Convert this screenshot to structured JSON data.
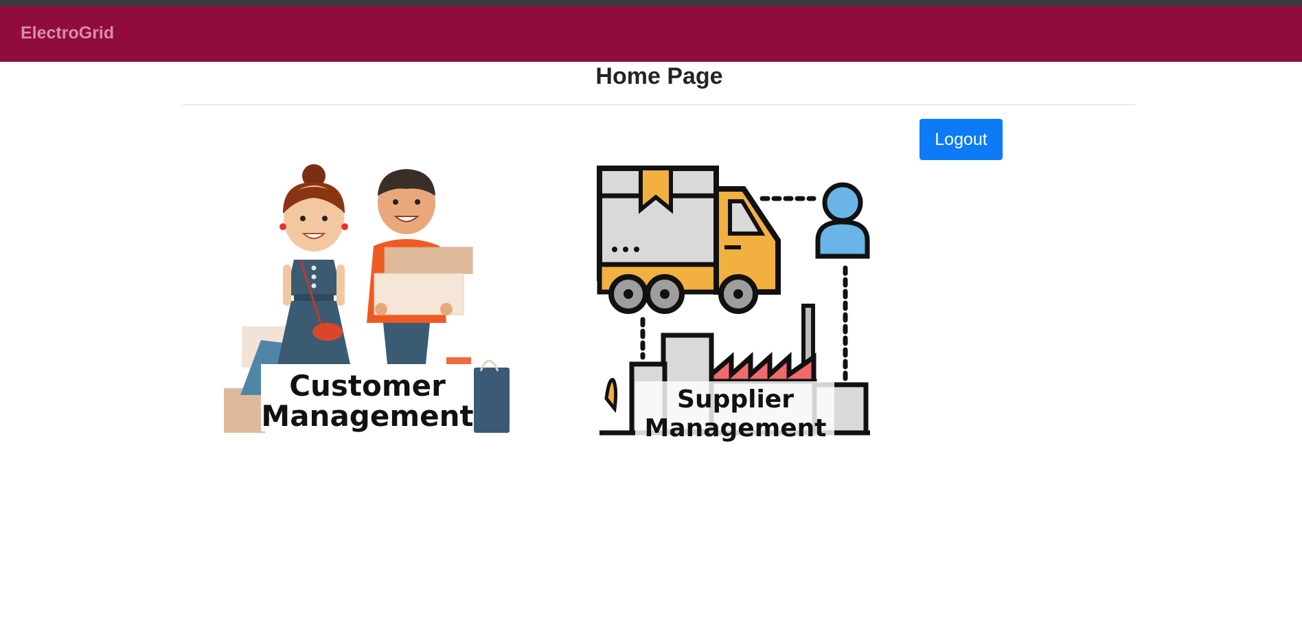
{
  "navbar": {
    "brand": "ElectroGrid",
    "color": "#900c3e"
  },
  "page": {
    "title": "Home Page"
  },
  "actions": {
    "logout_label": "Logout",
    "logout_color": "#0d7bf6"
  },
  "modules": [
    {
      "line1": "Customer",
      "line2": "Management"
    },
    {
      "line1": "Supplier",
      "line2": "Management"
    }
  ]
}
